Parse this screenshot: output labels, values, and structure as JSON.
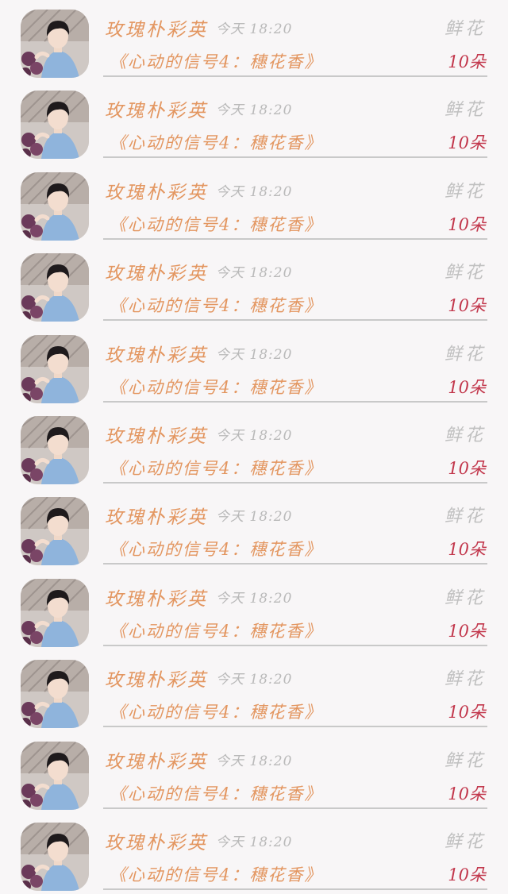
{
  "records": [
    {
      "sender": "玫瑰朴彩英",
      "time": "今天 18:20",
      "gift_type": "鲜花",
      "title": "《心动的信号4：穗花香》",
      "count": "10朵"
    },
    {
      "sender": "玫瑰朴彩英",
      "time": "今天 18:20",
      "gift_type": "鲜花",
      "title": "《心动的信号4：穗花香》",
      "count": "10朵"
    },
    {
      "sender": "玫瑰朴彩英",
      "time": "今天 18:20",
      "gift_type": "鲜花",
      "title": "《心动的信号4：穗花香》",
      "count": "10朵"
    },
    {
      "sender": "玫瑰朴彩英",
      "time": "今天 18:20",
      "gift_type": "鲜花",
      "title": "《心动的信号4：穗花香》",
      "count": "10朵"
    },
    {
      "sender": "玫瑰朴彩英",
      "time": "今天 18:20",
      "gift_type": "鲜花",
      "title": "《心动的信号4：穗花香》",
      "count": "10朵"
    },
    {
      "sender": "玫瑰朴彩英",
      "time": "今天 18:20",
      "gift_type": "鲜花",
      "title": "《心动的信号4：穗花香》",
      "count": "10朵"
    },
    {
      "sender": "玫瑰朴彩英",
      "time": "今天 18:20",
      "gift_type": "鲜花",
      "title": "《心动的信号4：穗花香》",
      "count": "10朵"
    },
    {
      "sender": "玫瑰朴彩英",
      "time": "今天 18:20",
      "gift_type": "鲜花",
      "title": "《心动的信号4：穗花香》",
      "count": "10朵"
    },
    {
      "sender": "玫瑰朴彩英",
      "time": "今天 18:20",
      "gift_type": "鲜花",
      "title": "《心动的信号4：穗花香》",
      "count": "10朵"
    },
    {
      "sender": "玫瑰朴彩英",
      "time": "今天 18:20",
      "gift_type": "鲜花",
      "title": "《心动的信号4：穗花香》",
      "count": "10朵"
    },
    {
      "sender": "玫瑰朴彩英",
      "time": "今天 18:20",
      "gift_type": "鲜花",
      "title": "《心动的信号4：穗花香》",
      "count": "10朵"
    }
  ],
  "colors": {
    "sender": "#e39660",
    "title": "#e39660",
    "time": "#b9b9b9",
    "gift_type": "#c0c0c0",
    "count": "#c2374c",
    "background": "#f8f6f7",
    "divider": "#c9c9c9"
  },
  "icons": {
    "avatar": "user-photo-avatar"
  }
}
